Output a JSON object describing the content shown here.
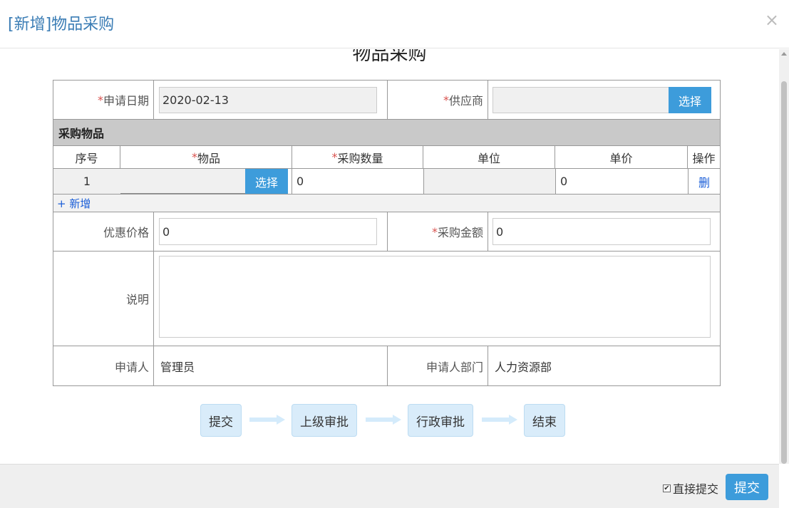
{
  "modal": {
    "title": "[新增]物品采购",
    "close": "×"
  },
  "form": {
    "title": "物品采购",
    "apply_date_label": "申请日期",
    "apply_date_value": "2020-02-13",
    "supplier_label": "供应商",
    "supplier_value": "",
    "select_label": "选择",
    "required_mark": "*",
    "items_section": "采购物品",
    "columns": [
      "序号",
      "物品",
      "采购数量",
      "单位",
      "单价",
      "操作"
    ],
    "item_row": {
      "index": "1",
      "item": "",
      "quantity": "0",
      "unit": "",
      "price": "0",
      "delete": "删"
    },
    "add_label": "+ 新增",
    "discount_label": "优惠价格",
    "discount_value": "0",
    "amount_label": "采购金额",
    "amount_value": "0",
    "desc_label": "说明",
    "desc_value": "",
    "applicant_label": "申请人",
    "applicant_value": "管理员",
    "dept_label": "申请人部门",
    "dept_value": "人力资源部"
  },
  "flow": {
    "steps": [
      "提交",
      "上级审批",
      "行政审批",
      "结束"
    ]
  },
  "footer": {
    "direct_submit_label": "直接提交",
    "direct_submit_checked": true,
    "submit_label": "提交"
  },
  "colors": {
    "accent": "#3d9cdb",
    "title": "#3b7db5",
    "required": "#d9534f",
    "link": "#1a5ed8",
    "step_bg": "#d9ecfa"
  }
}
